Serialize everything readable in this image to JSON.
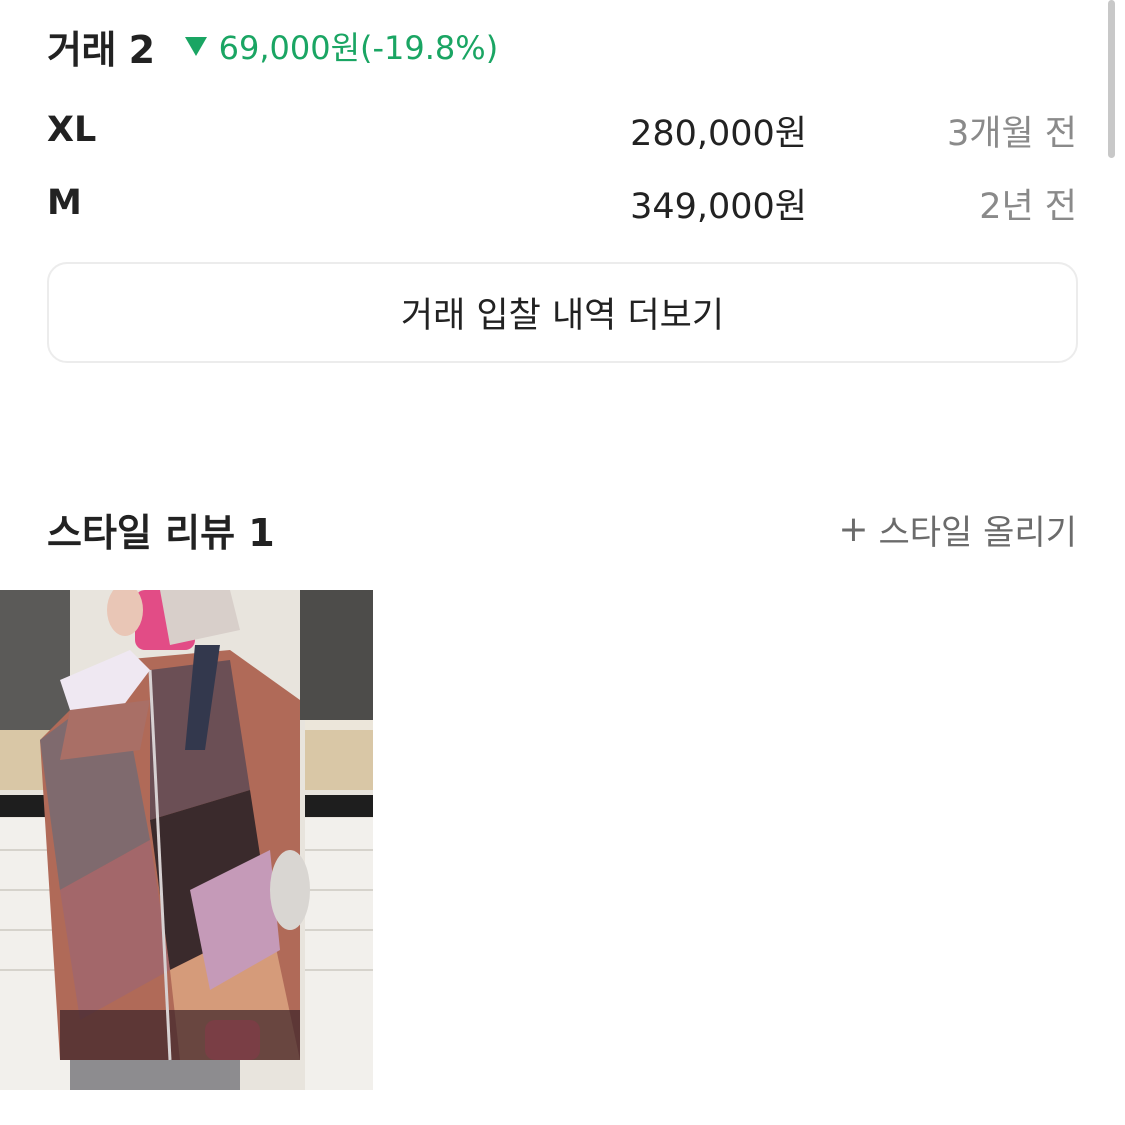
{
  "trades": {
    "title": "거래 2",
    "change_text": "69,000원(-19.8%)",
    "rows": [
      {
        "size": "XL",
        "price": "280,000원",
        "time": "3개월 전"
      },
      {
        "size": "M",
        "price": "349,000원",
        "time": "2년 전"
      }
    ],
    "more_label": "거래 입찰 내역 더보기"
  },
  "reviews": {
    "title": "스타일 리뷰 1",
    "upload_label": "스타일 올리기",
    "upload_icon": "plus-icon"
  },
  "colors": {
    "down": "#1aa563",
    "muted": "#8a8a8a"
  }
}
